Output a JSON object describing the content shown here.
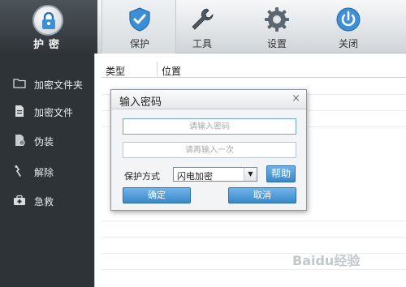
{
  "brand": {
    "name": "护密"
  },
  "tabs": [
    {
      "label": "保护",
      "icon": "shield-icon",
      "active": true
    },
    {
      "label": "工具",
      "icon": "wrench-icon",
      "active": false
    },
    {
      "label": "设置",
      "icon": "gear-icon",
      "active": false
    },
    {
      "label": "关闭",
      "icon": "power-icon",
      "active": false
    }
  ],
  "sidebar": {
    "items": [
      {
        "label": "加密文件夹",
        "icon": "folder-icon"
      },
      {
        "label": "加密文件",
        "icon": "file-icon"
      },
      {
        "label": "伪装",
        "icon": "disguise-icon"
      },
      {
        "label": "解除",
        "icon": "unlock-icon"
      },
      {
        "label": "急救",
        "icon": "first-aid-icon"
      }
    ]
  },
  "table": {
    "columns": [
      "类型",
      "位置"
    ]
  },
  "dialog": {
    "title": "输入密码",
    "close_glyph": "×",
    "password_placeholder": "请输入密码",
    "confirm_placeholder": "请再输入一次",
    "protect_label": "保护方式",
    "protect_value": "闪电加密",
    "help_label": "帮助",
    "ok_label": "确定",
    "cancel_label": "取消"
  },
  "watermark": "Baidu经验",
  "colors": {
    "accent": "#3a88cc",
    "sidebar_bg": "#2e3338",
    "brand_bg": "#3a4046"
  }
}
